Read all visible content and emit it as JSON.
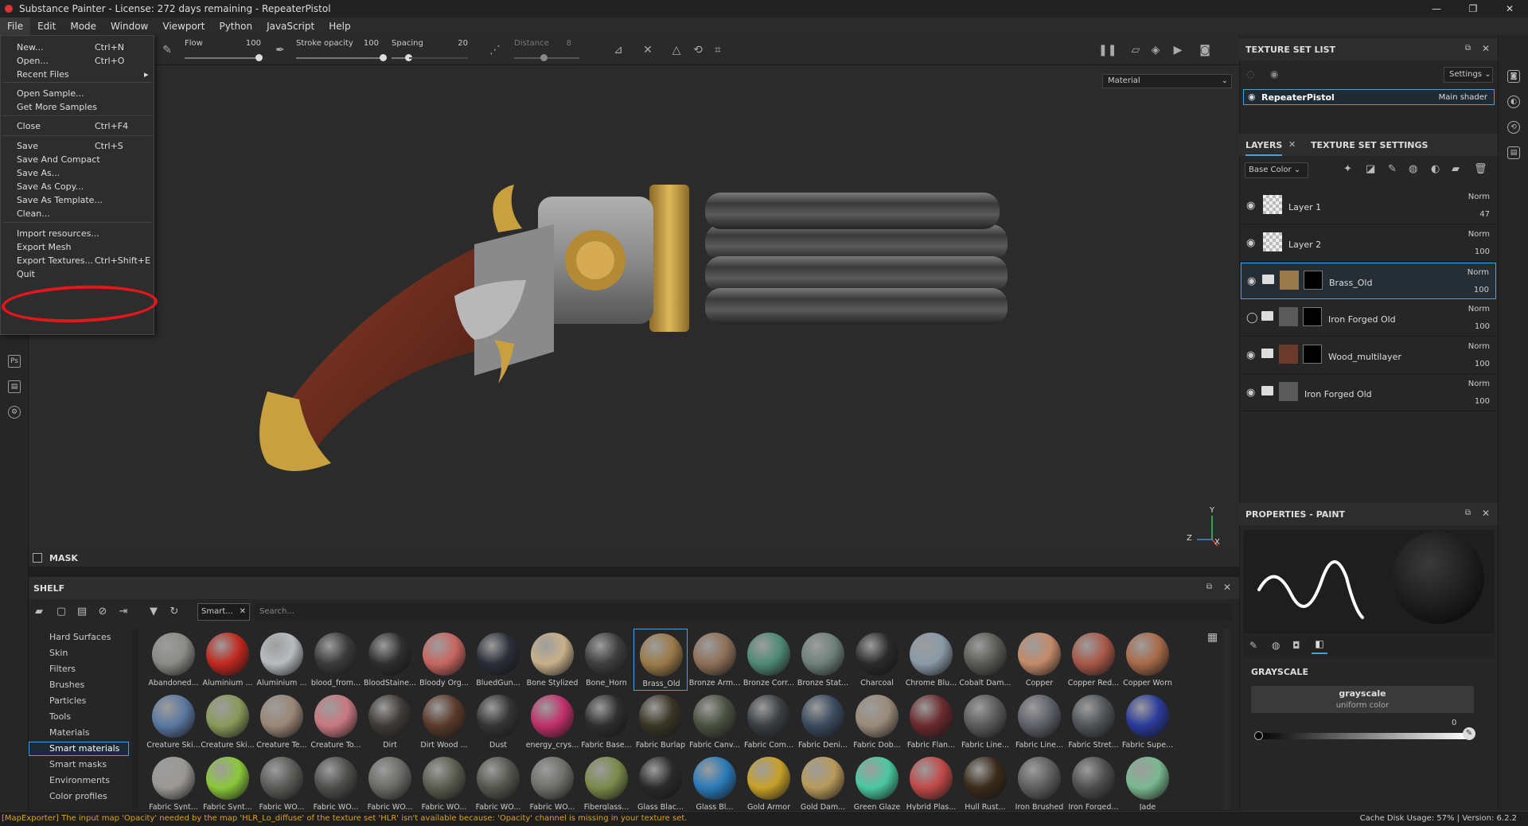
{
  "window": {
    "title": "Substance Painter - License: 272 days remaining - RepeaterPistol",
    "controls": [
      "—",
      "❐",
      "✕"
    ]
  },
  "menubar": [
    "File",
    "Edit",
    "Mode",
    "Window",
    "Viewport",
    "Python",
    "JavaScript",
    "Help"
  ],
  "file_menu": {
    "items": [
      {
        "label": "New...",
        "shortcut": "Ctrl+N"
      },
      {
        "label": "Open...",
        "shortcut": "Ctrl+O"
      },
      {
        "label": "Recent Files",
        "shortcut": "▸"
      },
      {
        "label": "Open Sample...",
        "shortcut": ""
      },
      {
        "label": "Get More Samples",
        "shortcut": ""
      },
      {
        "label": "Close",
        "shortcut": "Ctrl+F4"
      },
      {
        "label": "Save",
        "shortcut": "Ctrl+S"
      },
      {
        "label": "Save And Compact",
        "shortcut": ""
      },
      {
        "label": "Save As...",
        "shortcut": ""
      },
      {
        "label": "Save As Copy...",
        "shortcut": ""
      },
      {
        "label": "Save As Template...",
        "shortcut": ""
      },
      {
        "label": "Clean...",
        "shortcut": ""
      },
      {
        "label": "Import resources...",
        "shortcut": ""
      },
      {
        "label": "Export Mesh",
        "shortcut": ""
      },
      {
        "label": "Export Textures...",
        "shortcut": "Ctrl+Shift+E"
      },
      {
        "label": "Quit",
        "shortcut": ""
      }
    ]
  },
  "toolbar": {
    "flow_label": "Flow",
    "flow_value": "100",
    "stroke_opacity_label": "Stroke opacity",
    "stroke_opacity_value": "100",
    "spacing_label": "Spacing",
    "spacing_value": "20",
    "distance_label": "Distance",
    "distance_value": "8"
  },
  "viewport": {
    "material_select": "Material",
    "mask_label": "MASK",
    "axis_y": "Y",
    "axis_z": "Z",
    "axis_x": "X"
  },
  "shelf": {
    "title": "SHELF",
    "filter_chip": "Smart...",
    "search_placeholder": "Search...",
    "categories": [
      "Hard Surfaces",
      "Skin",
      "Filters",
      "Brushes",
      "Particles",
      "Tools",
      "Materials",
      "Smart materials",
      "Smart masks",
      "Environments",
      "Color profiles"
    ],
    "selected_category": "Smart materials",
    "materials": [
      {
        "name": "Abandoned...",
        "color": "#8a8a86"
      },
      {
        "name": "Aluminium ...",
        "color": "#c0281e"
      },
      {
        "name": "Aluminium ...",
        "color": "#b8bcc0"
      },
      {
        "name": "blood_from...",
        "color": "#3a3a3a"
      },
      {
        "name": "BloodStaine...",
        "color": "#2e2e2e"
      },
      {
        "name": "Bloody Org...",
        "color": "#c86660"
      },
      {
        "name": "BluedGun...",
        "color": "#2a2e38"
      },
      {
        "name": "Bone Stylized",
        "color": "#c8b08a"
      },
      {
        "name": "Bone_Horn",
        "color": "#3e3e3e"
      },
      {
        "name": "Brass_Old",
        "color": "#9a7a48"
      },
      {
        "name": "Bronze Arm...",
        "color": "#8e7058"
      },
      {
        "name": "Bronze Corr...",
        "color": "#4e8a74"
      },
      {
        "name": "Bronze Stat...",
        "color": "#6e807a"
      },
      {
        "name": "Charcoal",
        "color": "#2a2a2a"
      },
      {
        "name": "Chrome Blu...",
        "color": "#8a9aa8"
      },
      {
        "name": "Cobalt Dam...",
        "color": "#5a5a56"
      },
      {
        "name": "Copper",
        "color": "#c48a6a"
      },
      {
        "name": "Copper Red...",
        "color": "#a85848"
      },
      {
        "name": "Copper Worn",
        "color": "#a86a48"
      },
      {
        "name": "Creature Ski...",
        "color": "#5a78a0"
      },
      {
        "name": "Creature Ski...",
        "color": "#8a9a5a"
      },
      {
        "name": "Creature Te...",
        "color": "#9a8676"
      },
      {
        "name": "Creature To...",
        "color": "#c87880"
      },
      {
        "name": "Dirt",
        "color": "#3e3a36"
      },
      {
        "name": "Dirt Wood ...",
        "color": "#5a3a2a"
      },
      {
        "name": "Dust",
        "color": "#343434"
      },
      {
        "name": "energy_crys...",
        "color": "#c0306a"
      },
      {
        "name": "Fabric Base...",
        "color": "#2e2e2e"
      },
      {
        "name": "Fabric Burlap",
        "color": "#3a3626"
      },
      {
        "name": "Fabric Canv...",
        "color": "#4a5040"
      },
      {
        "name": "Fabric Com...",
        "color": "#3a3e42"
      },
      {
        "name": "Fabric Deni...",
        "color": "#3a4a5e"
      },
      {
        "name": "Fabric Dob...",
        "color": "#9a8a78"
      },
      {
        "name": "Fabric Flan...",
        "color": "#6a2a2e"
      },
      {
        "name": "Fabric Line...",
        "color": "#5a5a5a"
      },
      {
        "name": "Fabric Line...",
        "color": "#5e6068"
      },
      {
        "name": "Fabric Stret...",
        "color": "#505458"
      },
      {
        "name": "Fabric Supe...",
        "color": "#2a3a9a"
      },
      {
        "name": "Fabric Synt...",
        "color": "#9a9894"
      },
      {
        "name": "Fabric Synt...",
        "color": "#8ac83a"
      },
      {
        "name": "Fabric WO...",
        "color": "#5a5a58"
      },
      {
        "name": "Fabric WO...",
        "color": "#4e4e4c"
      },
      {
        "name": "Fabric WO...",
        "color": "#6a6a66"
      },
      {
        "name": "Fabric WO...",
        "color": "#5a5c4e"
      },
      {
        "name": "Fabric WO...",
        "color": "#54564e"
      },
      {
        "name": "Fabric WO...",
        "color": "#6e6e6a"
      },
      {
        "name": "Fiberglass...",
        "color": "#7a8a4a"
      },
      {
        "name": "Glass Blac...",
        "color": "#2a2a2a"
      },
      {
        "name": "Glass Bl...",
        "color": "#2a7ab8"
      },
      {
        "name": "Gold Armor",
        "color": "#c8a028"
      },
      {
        "name": "Gold Dam...",
        "color": "#b89a5a"
      },
      {
        "name": "Green Glaze",
        "color": "#4ac8a0"
      },
      {
        "name": "Hybrid Plas...",
        "color": "#c04848"
      },
      {
        "name": "Hull Rust...",
        "color": "#3a2a1a"
      },
      {
        "name": "Iron Brushed",
        "color": "#5e5e5e"
      },
      {
        "name": "Iron Forged...",
        "color": "#4e4e4e"
      },
      {
        "name": "Jade",
        "color": "#7ab890"
      }
    ]
  },
  "texture_set_list": {
    "title": "TEXTURE SET LIST",
    "settings": "Settings",
    "item_name": "RepeaterPistol",
    "item_shader": "Main shader"
  },
  "layers": {
    "tab_layers": "LAYERS",
    "tab_tss": "TEXTURE SET SETTINGS",
    "channel": "Base Color",
    "items": [
      {
        "name": "Layer 1",
        "blend": "Norm",
        "opacity": "47",
        "folder": false,
        "thumb": "checker",
        "mask": false,
        "visible": true
      },
      {
        "name": "Layer 2",
        "blend": "Norm",
        "opacity": "100",
        "folder": false,
        "thumb": "checker",
        "mask": false,
        "visible": true
      },
      {
        "name": "Brass_Old",
        "blend": "Norm",
        "opacity": "100",
        "folder": true,
        "thumb": "#9a7a48",
        "mask": true,
        "visible": true
      },
      {
        "name": "Iron Forged Old",
        "blend": "Norm",
        "opacity": "100",
        "folder": true,
        "thumb": "#5a5a5a",
        "mask": true,
        "visible": false
      },
      {
        "name": "Wood_multilayer",
        "blend": "Norm",
        "opacity": "100",
        "folder": true,
        "thumb": "#6a3a2a",
        "mask": true,
        "visible": true
      },
      {
        "name": "Iron Forged Old",
        "blend": "Norm",
        "opacity": "100",
        "folder": true,
        "thumb": "#5a5a5a",
        "mask": false,
        "visible": true
      }
    ]
  },
  "properties": {
    "title": "PROPERTIES - PAINT",
    "grayscale_label": "GRAYSCALE",
    "grayscale_title": "grayscale",
    "grayscale_sub": "uniform color",
    "grayscale_value": "0"
  },
  "statusbar": {
    "message": "[MapExporter] The input map 'Opacity' needed by the map 'HLR_Lo_diffuse' of the texture set 'HLR' isn't available because: 'Opacity' channel is missing in your texture set.",
    "cache": "Cache Disk Usage:   57% | Version: 6.2.2"
  }
}
